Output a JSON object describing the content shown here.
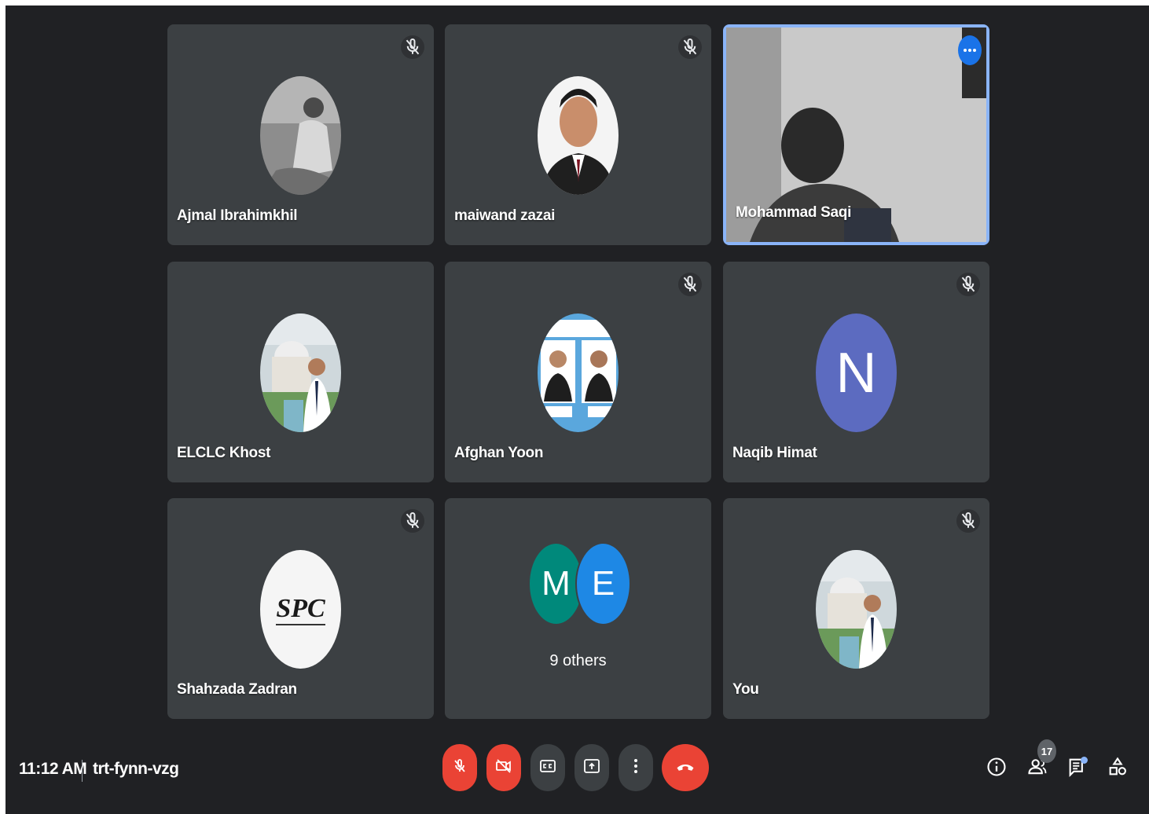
{
  "meeting": {
    "time": "11:12 AM",
    "code": "trt-fynn-vzg",
    "participant_count": "17"
  },
  "tiles": [
    {
      "name": "Ajmal Ibrahimkhil",
      "muted": true
    },
    {
      "name": "maiwand zazai",
      "muted": true
    },
    {
      "name": "Mohammad Saqi",
      "muted": false,
      "video": true
    },
    {
      "name": "ELCLC Khost",
      "muted": false
    },
    {
      "name": "Afghan Yoon",
      "muted": true
    },
    {
      "name": "Naqib Himat",
      "muted": true,
      "initial": "N"
    },
    {
      "name": "Shahzada Zadran",
      "muted": true,
      "logo_text": "SPC"
    },
    {
      "name": "9 others",
      "initials": [
        "M",
        "E"
      ]
    },
    {
      "name": "You",
      "muted": true
    }
  ],
  "colors": {
    "background": "#202124",
    "tile": "#3c4043",
    "active_border": "#8ab4f8",
    "danger": "#ea4335",
    "avatar_N": "#5c6bc0",
    "avatar_M": "#00897b",
    "avatar_E": "#1e88e5"
  },
  "icons": [
    "mic-off-icon",
    "camera-off-icon",
    "captions-icon",
    "present-icon",
    "more-vert-icon",
    "call-end-icon",
    "info-icon",
    "people-icon",
    "chat-icon",
    "activities-icon"
  ]
}
